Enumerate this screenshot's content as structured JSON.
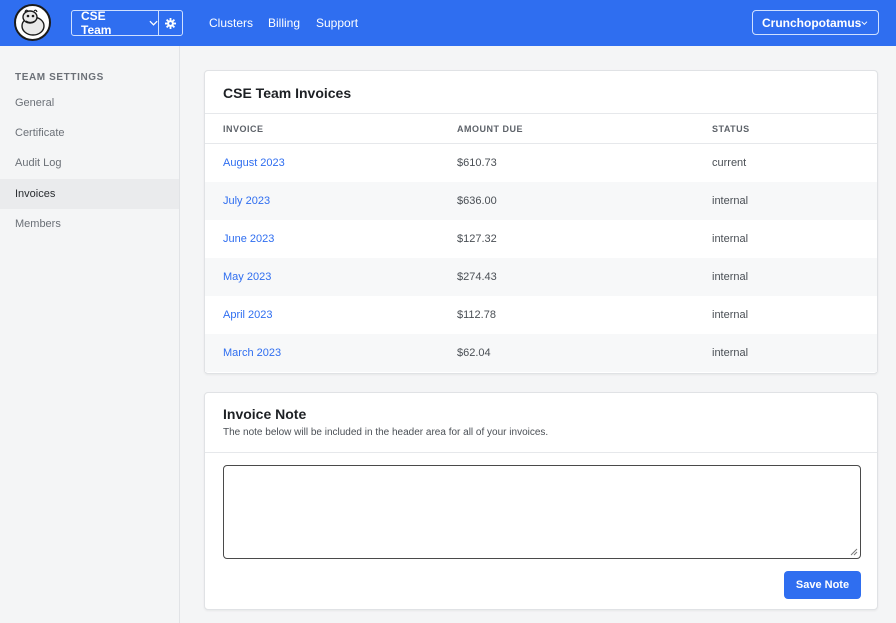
{
  "header": {
    "team_select": {
      "label": "CSE Team"
    },
    "nav": [
      {
        "label": "Clusters"
      },
      {
        "label": "Billing"
      },
      {
        "label": "Support"
      }
    ],
    "user_menu": {
      "label": "Crunchopotamus"
    }
  },
  "sidebar": {
    "heading": "TEAM SETTINGS",
    "items": [
      {
        "label": "General"
      },
      {
        "label": "Certificate"
      },
      {
        "label": "Audit Log"
      },
      {
        "label": "Invoices",
        "active": true
      },
      {
        "label": "Members"
      }
    ]
  },
  "invoices": {
    "title": "CSE Team Invoices",
    "columns": [
      "INVOICE",
      "AMOUNT DUE",
      "STATUS"
    ],
    "rows": [
      {
        "invoice": "August 2023",
        "amount": "$610.73",
        "status": "current"
      },
      {
        "invoice": "July 2023",
        "amount": "$636.00",
        "status": "internal"
      },
      {
        "invoice": "June 2023",
        "amount": "$127.32",
        "status": "internal"
      },
      {
        "invoice": "May 2023",
        "amount": "$274.43",
        "status": "internal"
      },
      {
        "invoice": "April 2023",
        "amount": "$112.78",
        "status": "internal"
      },
      {
        "invoice": "March 2023",
        "amount": "$62.04",
        "status": "internal"
      }
    ]
  },
  "note": {
    "title": "Invoice Note",
    "subtitle": "The note below will be included in the header area for all of your invoices.",
    "value": "",
    "save_label": "Save Note"
  },
  "colors": {
    "accent": "#2f6ef0",
    "sidebar_bg": "#f4f5f6",
    "row_alt": "#f7f8f9"
  },
  "icons": {
    "logo": "hippo-logo-icon",
    "team_dropdown": "chevron-down-icon",
    "team_settings": "gear-icon",
    "user_dropdown": "chevron-down-icon"
  }
}
